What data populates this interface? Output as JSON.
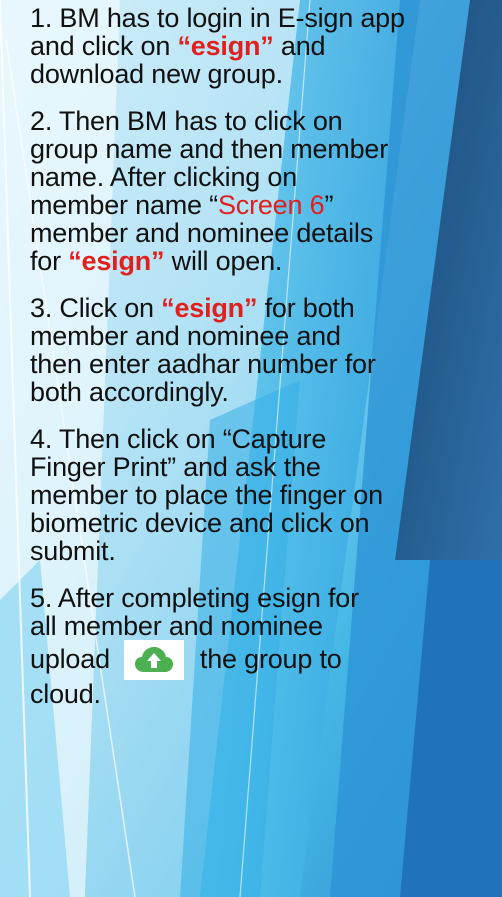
{
  "colors": {
    "background_light": "#dff2fb",
    "background_mid": "#55c3ea",
    "background_dark": "#2a5a86",
    "text": "#111111",
    "highlight": "#e0201e",
    "cloud_icon": "#4caf50"
  },
  "steps": [
    {
      "line1": "1. BM has to login in E-sign app",
      "line2_pre": "and click on ",
      "line2_kw": "“esign”",
      "line2_post": " and",
      "line3": "download new group."
    },
    {
      "line1": "2. Then BM has to click on",
      "line2": "group name and then member",
      "line3": "name. After clicking on",
      "line4_pre": "member name “",
      "line4_screen": "Screen 6",
      "line4_post": "”",
      "line5": "member and nominee details",
      "line6_pre": "for ",
      "line6_kw": "“esign”",
      "line6_post": " will open."
    },
    {
      "line1_pre": "3. Click on ",
      "line1_kw": "“esign”",
      "line1_post": " for both",
      "line2": "member and nominee and",
      "line3": "then enter aadhar number for",
      "line4": "both accordingly."
    },
    {
      "line1": "4. Then click on “Capture",
      "line2": "Finger Print” and ask the",
      "line3": "member to place the finger on",
      "line4": "biometric device and click on",
      "line5": "submit."
    },
    {
      "line1": "5. After completing esign for",
      "line2": "all member and nominee",
      "line3_pre": "upload",
      "line3_icon": "cloud-upload-icon",
      "line3_post": "the group to",
      "line4": "cloud."
    }
  ]
}
